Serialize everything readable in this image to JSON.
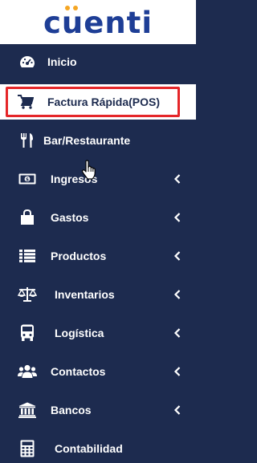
{
  "brand": {
    "logo_text_before": "c",
    "logo_text_u": "u",
    "logo_text_after": "enti",
    "logo_color": "#1e3e96",
    "dot_color": "#f5a623"
  },
  "colors": {
    "sidebar_bg": "#1d2b4f",
    "active_border": "#e52629",
    "text": "#ffffff"
  },
  "menu": [
    {
      "label": "Inicio",
      "icon": "dashboard-icon",
      "has_chevron": false
    },
    {
      "label": "Factura Rápida(POS)",
      "icon": "cart-icon",
      "has_chevron": false,
      "active": true
    },
    {
      "label": "Bar/Restaurante",
      "icon": "utensils-icon",
      "has_chevron": false
    },
    {
      "label": "Ingresos",
      "icon": "money-icon",
      "has_chevron": true
    },
    {
      "label": "Gastos",
      "icon": "shopping-bag-icon",
      "has_chevron": true
    },
    {
      "label": "Productos",
      "icon": "list-icon",
      "has_chevron": true
    },
    {
      "label": "Inventarios",
      "icon": "balance-scale-icon",
      "has_chevron": true
    },
    {
      "label": "Logística",
      "icon": "bus-icon",
      "has_chevron": true
    },
    {
      "label": "Contactos",
      "icon": "users-icon",
      "has_chevron": true
    },
    {
      "label": "Bancos",
      "icon": "bank-icon",
      "has_chevron": true
    },
    {
      "label": "Contabilidad",
      "icon": "calculator-icon",
      "has_chevron": false
    }
  ]
}
